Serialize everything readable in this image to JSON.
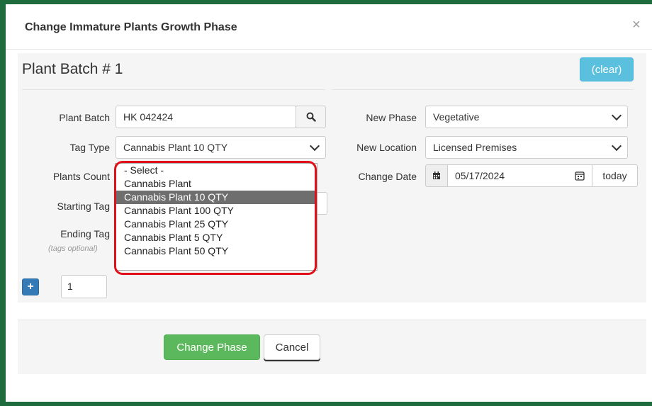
{
  "modal": {
    "title": "Change Immature Plants Growth Phase",
    "close": "×"
  },
  "batch": {
    "title": "Plant Batch # 1",
    "clear_label": "(clear)"
  },
  "left": {
    "plant_batch_label": "Plant Batch",
    "plant_batch_value": "HK 042424",
    "search_icon": "search-icon",
    "tag_type_label": "Tag Type",
    "tag_type_value": "Cannabis Plant 10 QTY",
    "plants_count_label": "Plants Count",
    "starting_tag_label": "Starting Tag",
    "ending_tag_label": "Ending Tag",
    "tags_optional": "(tags optional)"
  },
  "right": {
    "new_phase_label": "New Phase",
    "new_phase_value": "Vegetative",
    "new_location_label": "New Location",
    "new_location_value": "Licensed Premises",
    "change_date_label": "Change Date",
    "change_date_value": "05/17/2024",
    "calendar_icon": "calendar-icon",
    "today_label": "today"
  },
  "dropdown": {
    "options": [
      "- Select -",
      "Cannabis Plant",
      "Cannabis Plant 10 QTY",
      "Cannabis Plant 100 QTY",
      "Cannabis Plant 25 QTY",
      "Cannabis Plant 5 QTY",
      "Cannabis Plant 50 QTY"
    ],
    "selected_index": 2,
    "highlight_color": "#e0101a"
  },
  "add_row": {
    "count_value": "1"
  },
  "footer": {
    "change_phase_label": "Change Phase",
    "cancel_label": "Cancel"
  },
  "colors": {
    "frame": "#1e6b3e",
    "success": "#5cb85c",
    "info": "#5bc0de",
    "primary": "#337ab7"
  }
}
